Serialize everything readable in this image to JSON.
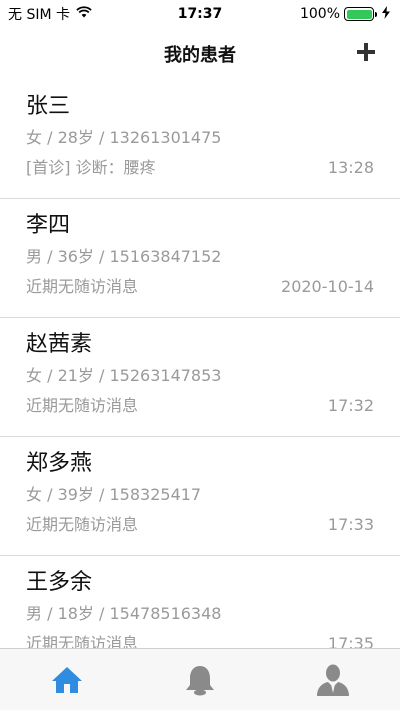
{
  "status_bar": {
    "carrier": "无 SIM 卡",
    "time": "17:37",
    "battery": "100%",
    "battery_level": 1.0,
    "wifi_icon": "wifi-icon",
    "charging_icon": "bolt-icon"
  },
  "nav": {
    "title": "我的患者",
    "add_icon": "plus-icon"
  },
  "patients": [
    {
      "name": "张三",
      "info": "女 / 28岁 / 13261301475",
      "message": "[首诊] 诊断：腰疼",
      "time": "13:28"
    },
    {
      "name": "李四",
      "info": "男 / 36岁 / 15163847152",
      "message": "近期无随访消息",
      "time": "2020-10-14"
    },
    {
      "name": "赵茜素",
      "info": "女 / 21岁 / 15263147853",
      "message": "近期无随访消息",
      "time": "17:32"
    },
    {
      "name": "郑多燕",
      "info": "女 / 39岁 / 158325417",
      "message": "近期无随访消息",
      "time": "17:33"
    },
    {
      "name": "王多余",
      "info": "男 / 18岁 / 15478516348",
      "message": "近期无随访消息",
      "time": "17:35"
    }
  ],
  "tab_bar": {
    "tabs": [
      {
        "icon": "home-icon",
        "active": true
      },
      {
        "icon": "bell-icon",
        "active": false
      },
      {
        "icon": "user-icon",
        "active": false
      }
    ],
    "active_color": "#2f8ce0",
    "inactive_color": "#8a8a8a"
  }
}
